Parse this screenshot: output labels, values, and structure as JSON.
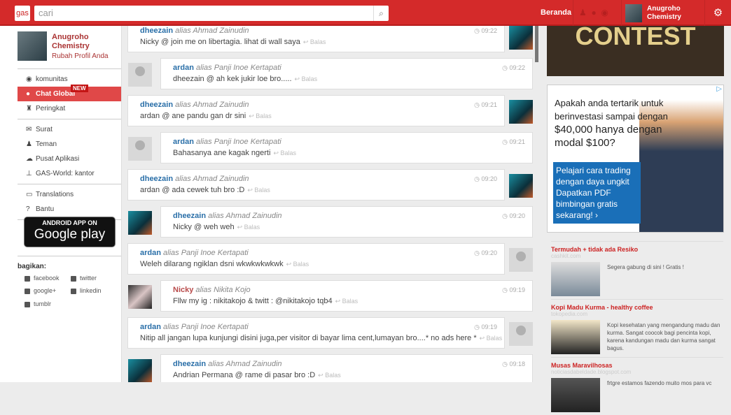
{
  "header": {
    "logo": "gas",
    "search_placeholder": "cari",
    "home": "Beranda",
    "user_name": "Anugroho Chemistry"
  },
  "profile": {
    "name": "Anugroho Chemistry",
    "edit_link": "Rubah Profil Anda"
  },
  "nav": [
    {
      "label": "komunitas",
      "icon": "globe-icon",
      "glyph": "◉"
    },
    {
      "label": "Chat Global",
      "icon": "chat-icon",
      "glyph": "●",
      "active": true,
      "badge": "NEW"
    },
    {
      "label": "Peringkat",
      "icon": "trophy-icon",
      "glyph": "♜"
    },
    {
      "label": "Surat",
      "icon": "envelope-icon",
      "glyph": "✉"
    },
    {
      "label": "Teman",
      "icon": "user-icon",
      "glyph": "♟"
    },
    {
      "label": "Pusat Aplikasi",
      "icon": "cloud-download-icon",
      "glyph": "☁"
    },
    {
      "label": "GAS-World: kantor",
      "icon": "sitemap-icon",
      "glyph": "⊥"
    },
    {
      "label": "Translations",
      "icon": "inbox-icon",
      "glyph": "▭"
    },
    {
      "label": "Bantu",
      "icon": "question-icon",
      "glyph": "?"
    }
  ],
  "google_play": {
    "line1": "ANDROID APP ON",
    "line2": "Google play"
  },
  "share": {
    "title": "bagikan:",
    "items": [
      "facebook",
      "twitter",
      "google+",
      "linkedin",
      "tumblr"
    ]
  },
  "messages": [
    {
      "user": "dheezain",
      "alias": "alias Ahmad Zainudin",
      "text": "Nicky @ join me on libertagia. lihat di wall saya",
      "time": "09:22",
      "side": "right",
      "avatar": "teal",
      "color": "#2a6fa8"
    },
    {
      "user": "ardan",
      "alias": "alias Panji Inoe Kertapati",
      "text": "dheezain @ ah kek jukir loe bro.....",
      "time": "09:22",
      "side": "left",
      "avatar": "gray",
      "color": "#2a6fa8"
    },
    {
      "user": "dheezain",
      "alias": "alias Ahmad Zainudin",
      "text": "ardan @ ane pandu gan dr sini",
      "time": "09:21",
      "side": "right",
      "avatar": "teal",
      "color": "#2a6fa8"
    },
    {
      "user": "ardan",
      "alias": "alias Panji Inoe Kertapati",
      "text": "Bahasanya ane kagak ngerti",
      "time": "09:21",
      "side": "left",
      "avatar": "gray",
      "color": "#2a6fa8"
    },
    {
      "user": "dheezain",
      "alias": "alias Ahmad Zainudin",
      "text": "ardan @ ada cewek tuh bro :D",
      "time": "09:20",
      "side": "right",
      "avatar": "teal",
      "color": "#2a6fa8"
    },
    {
      "user": "dheezain",
      "alias": "alias Ahmad Zainudin",
      "text": "Nicky @ weh weh",
      "time": "09:20",
      "side": "left",
      "avatar": "teal",
      "color": "#2a6fa8"
    },
    {
      "user": "ardan",
      "alias": "alias Panji Inoe Kertapati",
      "text": "Weleh dilarang ngiklan dsni wkwkwkwkwk",
      "time": "09:20",
      "side": "right",
      "avatar": "gray",
      "color": "#2a6fa8"
    },
    {
      "user": "Nicky",
      "alias": "alias Nikita Kojo",
      "text": "Fllw my ig : nikitakojo & twitt : @nikitakojo tqb4",
      "time": "09:19",
      "side": "left",
      "avatar": "pink",
      "color": "#b84a4a"
    },
    {
      "user": "ardan",
      "alias": "alias Panji Inoe Kertapati",
      "text": "Nitip all jangan lupa kunjungi disini juga,per visitor di bayar lima cent,lumayan bro....* no ads here *",
      "time": "09:19",
      "side": "right",
      "avatar": "gray",
      "color": "#2a6fa8"
    },
    {
      "user": "dheezain",
      "alias": "alias Ahmad Zainudin",
      "text": "Andrian Permana @ rame di pasar bro :D",
      "time": "09:18",
      "side": "left",
      "avatar": "teal",
      "color": "#2a6fa8"
    }
  ],
  "reply_label": "↩ Balas",
  "ads": {
    "banner": "CONTEST",
    "big": {
      "headline": "Apakah anda tertarik untuk berinvestasi sampai dengan",
      "amount": "$40,000 hanya dengan modal $100?",
      "box": "Pelajari cara trading dengan daya ungkit Dapatkan PDF bimbingan gratis sekarang! ›"
    },
    "items": [
      {
        "title": "Termudah + tidak ada Resiko",
        "domain": "cashkit.com",
        "text": "Segera gabung di sini ! Gratis !"
      },
      {
        "title": "Kopi Madu Kurma - healthy coffee",
        "domain": "tokopedia.com",
        "text": "Kopi kesehatan yang mengandung madu dan kurma. Sangat coocok bagi pencinta kopi, karena kandungan madu dan kurma sangat bagus."
      },
      {
        "title": "Musas Maravilhosas",
        "domain": "noticiasdabeldade.blogspot.com",
        "text": "frtgre estamos fazendo muito mos para vc"
      }
    ]
  }
}
